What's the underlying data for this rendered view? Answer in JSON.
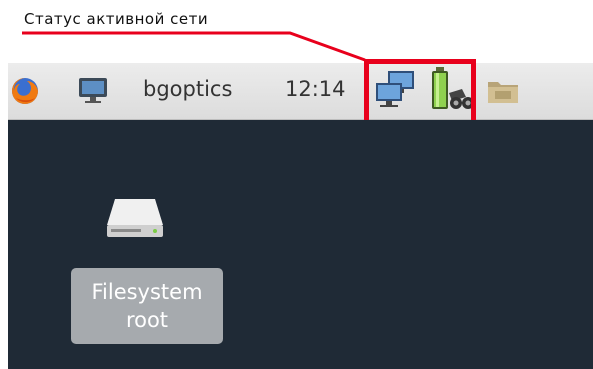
{
  "annotation": {
    "text": "Статус активной сети",
    "line_color": "#e8001c"
  },
  "panel": {
    "hostname": "bgoptics",
    "clock": "12:14",
    "icons": [
      "firefox-icon",
      "display-icon",
      "network-status-icon",
      "battery-icon",
      "folder-icon"
    ]
  },
  "desktop": {
    "background": "#1f2a36",
    "items": [
      {
        "icon": "drive-icon",
        "label_line1": "Filesystem",
        "label_line2": "root"
      }
    ]
  },
  "colors": {
    "highlight": "#e8001c",
    "panel_bg": "#e4e4e4",
    "label_bg": "#a6aaae"
  }
}
